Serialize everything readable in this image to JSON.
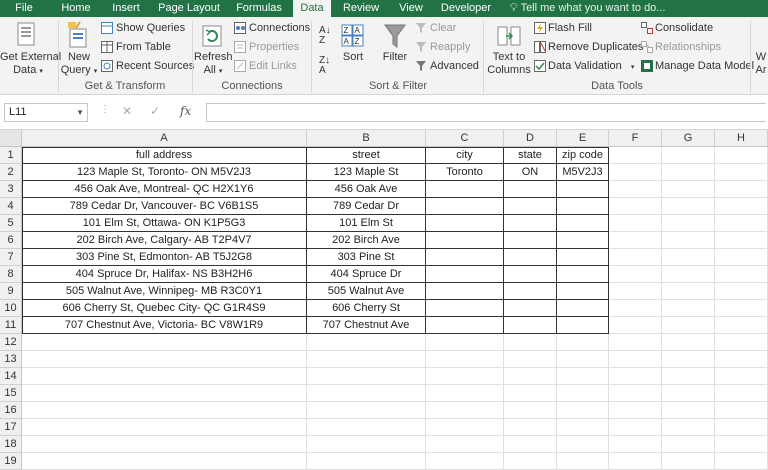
{
  "tabs": [
    "File",
    "Home",
    "Insert",
    "Page Layout",
    "Formulas",
    "Data",
    "Review",
    "View",
    "Developer"
  ],
  "active_tab": "Data",
  "tell_me": "Tell me what you want to do...",
  "ribbon": {
    "get_external_1": "Get External",
    "get_external_2": "Data",
    "new_query_1": "New",
    "new_query_2": "Query",
    "show_queries": "Show Queries",
    "from_table": "From Table",
    "recent_sources": "Recent Sources",
    "group_get_transform": "Get & Transform",
    "refresh_1": "Refresh",
    "refresh_2": "All",
    "connections": "Connections",
    "properties": "Properties",
    "edit_links": "Edit Links",
    "group_connections": "Connections",
    "sort": "Sort",
    "filter": "Filter",
    "clear": "Clear",
    "reapply": "Reapply",
    "advanced": "Advanced",
    "group_sort_filter": "Sort & Filter",
    "text_to_1": "Text to",
    "text_to_2": "Columns",
    "flash_fill": "Flash Fill",
    "remove_duplicates": "Remove Duplicates",
    "data_validation": "Data Validation",
    "consolidate": "Consolidate",
    "relationships": "Relationships",
    "manage_data_model": "Manage Data Model",
    "group_data_tools": "Data Tools",
    "whatif_1": "W",
    "whatif_2": "Ar"
  },
  "formula_bar": {
    "name_box": "L11",
    "cancel": "✕",
    "enter": "✓",
    "fx": "fx",
    "value": ""
  },
  "columns": [
    "A",
    "B",
    "C",
    "D",
    "E",
    "F",
    "G",
    "H"
  ],
  "rows": [
    [
      "full address",
      "street",
      "city",
      "state",
      "zip code"
    ],
    [
      "123 Maple St, Toronto- ON M5V2J3",
      "123 Maple St",
      "Toronto",
      "ON",
      "M5V2J3"
    ],
    [
      "456 Oak Ave, Montreal- QC H2X1Y6",
      "456 Oak Ave",
      "",
      "",
      ""
    ],
    [
      "789 Cedar Dr, Vancouver- BC V6B1S5",
      "789 Cedar Dr",
      "",
      "",
      ""
    ],
    [
      "101 Elm St, Ottawa- ON K1P5G3",
      "101 Elm St",
      "",
      "",
      ""
    ],
    [
      "202 Birch Ave, Calgary- AB T2P4V7",
      "202 Birch Ave",
      "",
      "",
      ""
    ],
    [
      "303 Pine St, Edmonton- AB T5J2G8",
      "303 Pine St",
      "",
      "",
      ""
    ],
    [
      "404 Spruce Dr, Halifax- NS B3H2H6",
      "404 Spruce Dr",
      "",
      "",
      ""
    ],
    [
      "505 Walnut Ave, Winnipeg- MB R3C0Y1",
      "505 Walnut Ave",
      "",
      "",
      ""
    ],
    [
      "606 Cherry St, Quebec City- QC G1R4S9",
      "606 Cherry St",
      "",
      "",
      ""
    ],
    [
      "707 Chestnut Ave, Victoria- BC V8W1R9",
      "707 Chestnut Ave",
      "",
      "",
      ""
    ]
  ],
  "row_numbers": [
    "1",
    "2",
    "3",
    "4",
    "5",
    "6",
    "7",
    "8",
    "9",
    "10",
    "11",
    "12",
    "13",
    "14",
    "15",
    "16",
    "17",
    "18",
    "19"
  ],
  "colors": {
    "accent": "#217346",
    "ribbon_bg": "#f3f3f3"
  }
}
